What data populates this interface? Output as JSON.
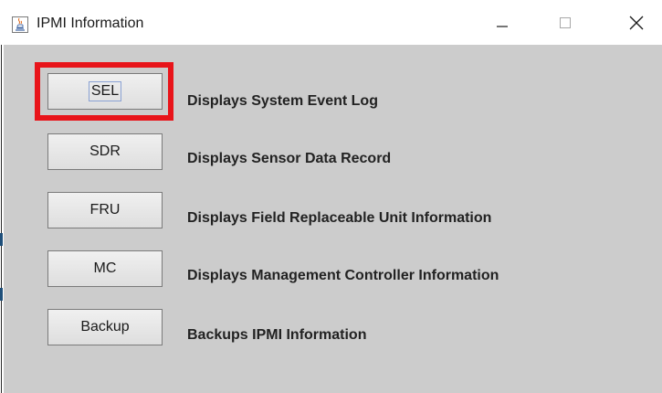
{
  "window": {
    "title": "IPMI Information",
    "icon": "java-cup-icon",
    "controls": {
      "minimize": "minimize-icon",
      "maximize": "maximize-icon",
      "close": "close-icon"
    }
  },
  "rows": [
    {
      "button_label": "SEL",
      "description": "Displays System Event Log"
    },
    {
      "button_label": "SDR",
      "description": "Displays Sensor Data Record"
    },
    {
      "button_label": "FRU",
      "description": "Displays Field Replaceable Unit Information"
    },
    {
      "button_label": "MC",
      "description": "Displays Management Controller Information"
    },
    {
      "button_label": "Backup",
      "description": "Backups IPMI Information"
    }
  ],
  "colors": {
    "window_background": "#cccccc",
    "titlebar_background": "#ffffff",
    "highlight_border": "#e8141a"
  }
}
